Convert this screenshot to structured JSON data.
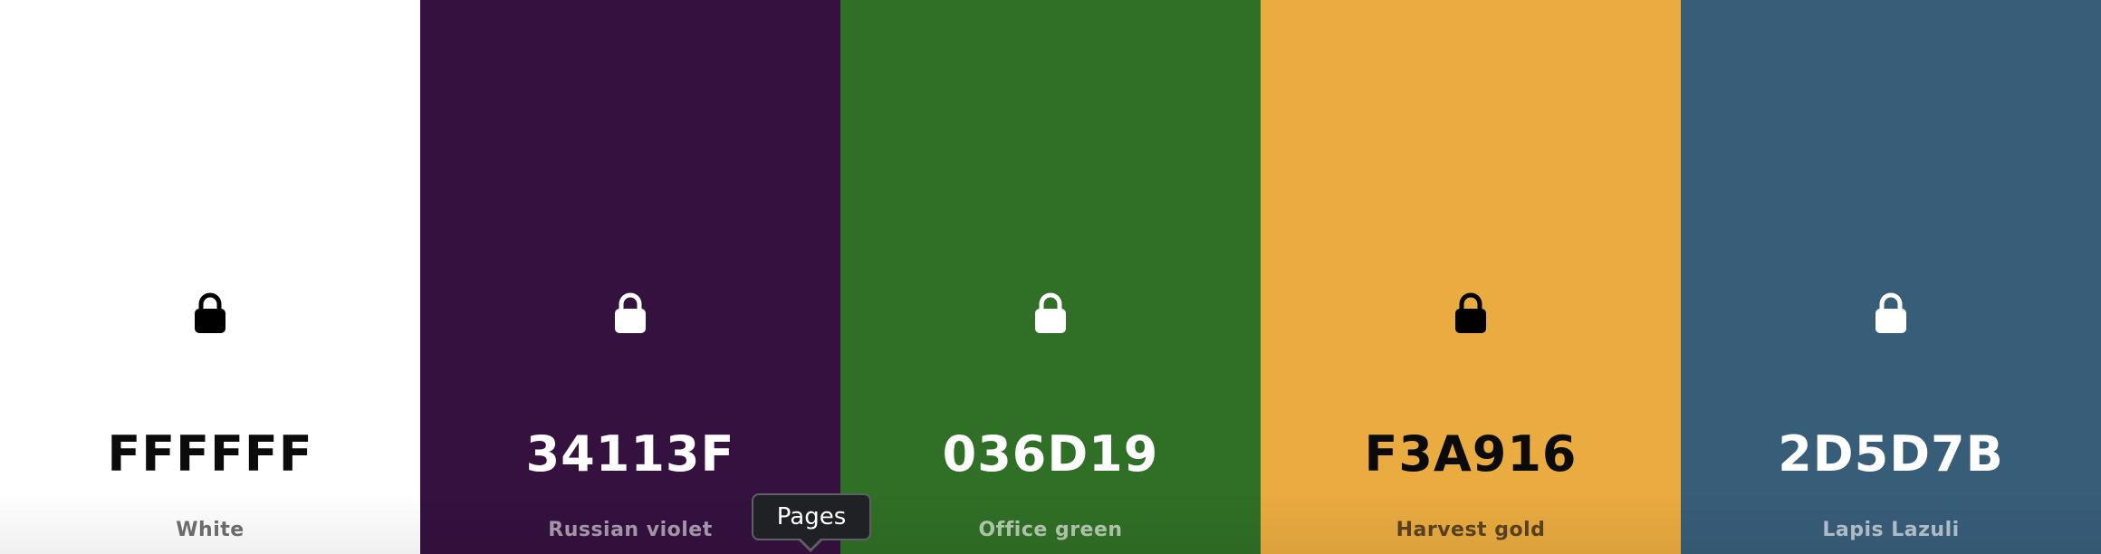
{
  "palette": {
    "swatches": [
      {
        "hex": "FFFFFF",
        "name": "White",
        "color": "#FFFFFF",
        "text_color": "#0b0b0b",
        "name_color": "#6f6f6f",
        "icon": "lock-icon",
        "icon_color": "#000000",
        "locked": true
      },
      {
        "hex": "34113F",
        "name": "Russian violet",
        "color": "#34113F",
        "text_color": "#ffffff",
        "name_color": "#a99aae",
        "icon": "lock-icon",
        "icon_color": "#ffffff",
        "locked": true
      },
      {
        "hex": "036D19",
        "name": "Office green",
        "color": "#306F26",
        "text_color": "#ffffff",
        "name_color": "#b3c9ae",
        "icon": "lock-icon",
        "icon_color": "#ffffff",
        "locked": true
      },
      {
        "hex": "F3A916",
        "name": "Harvest gold",
        "color": "#EAAB40",
        "text_color": "#0b0b0b",
        "name_color": "#5a4320",
        "icon": "lock-icon",
        "icon_color": "#000000",
        "locked": true
      },
      {
        "hex": "2D5D7B",
        "name": "Lapis Lazuli",
        "color": "#385D79",
        "text_color": "#ffffff",
        "name_color": "#b5c3cd",
        "icon": "lock-icon",
        "icon_color": "#ffffff",
        "locked": true
      }
    ]
  },
  "tooltip": {
    "label": "Pages"
  }
}
